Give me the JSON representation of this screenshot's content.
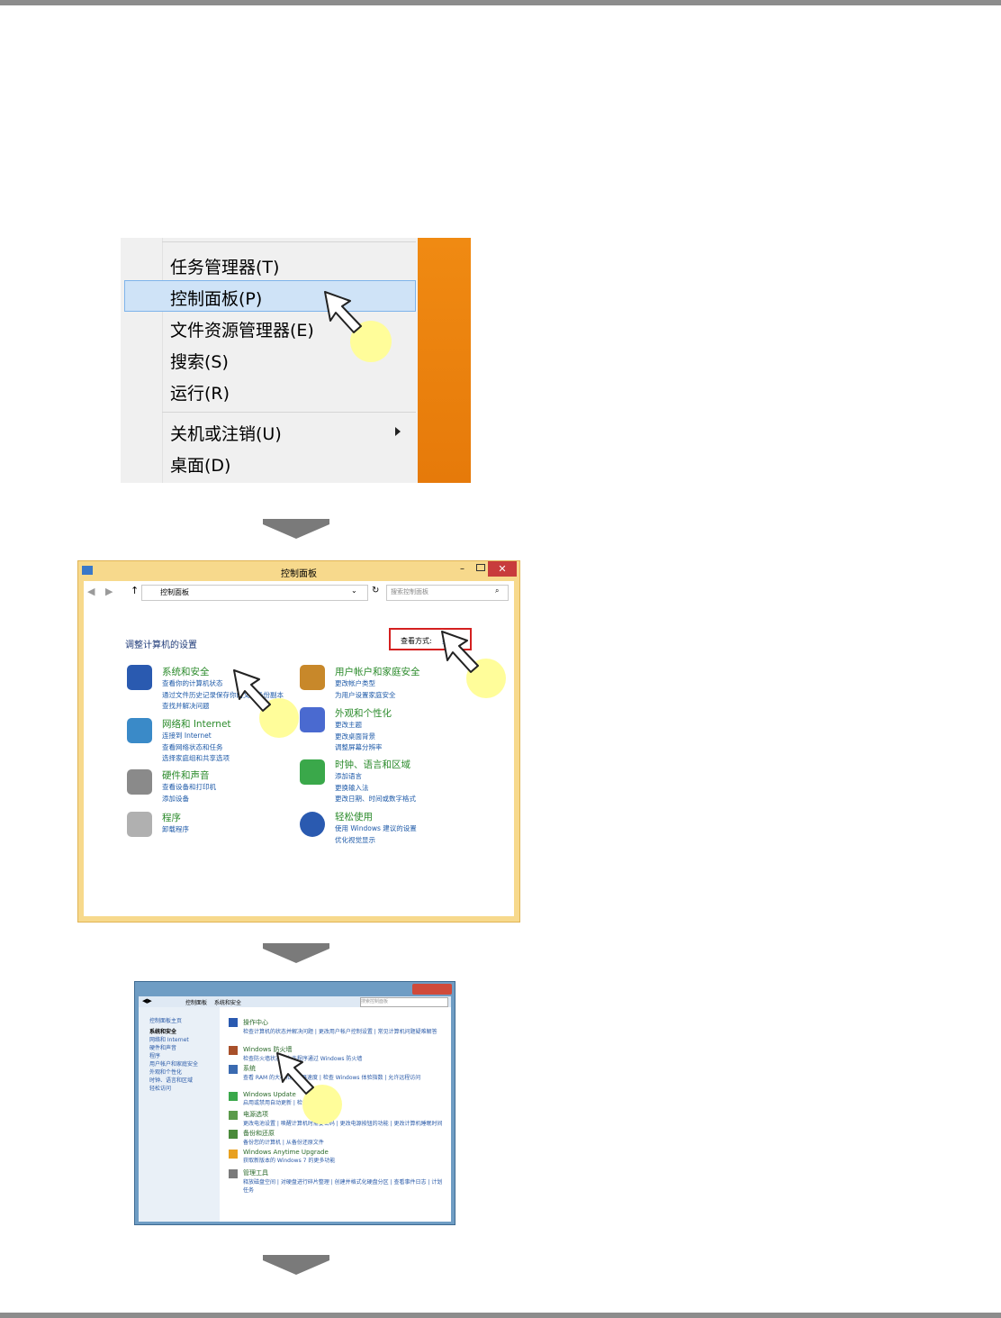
{
  "context_menu": {
    "items": [
      "任务管理器(T)",
      "控制面板(P)",
      "文件资源管理器(E)",
      "搜索(S)",
      "运行(R)",
      "关机或注销(U)",
      "桌面(D)"
    ]
  },
  "control_panel": {
    "window_title": "控制面板",
    "breadcrumb": "控制面板",
    "search_placeholder": "搜索控制面板",
    "heading": "调整计算机的设置",
    "view_by_label": "查看方式:",
    "view_by_value": "类别",
    "categories": [
      {
        "title": "系统和安全",
        "links": [
          "查看你的计算机状态",
          "通过文件历史记录保存你的文件备份副本",
          "查找并解决问题"
        ]
      },
      {
        "title": "网络和 Internet",
        "links": [
          "连接到 Internet",
          "查看网络状态和任务",
          "选择家庭组和共享选项"
        ]
      },
      {
        "title": "硬件和声音",
        "links": [
          "查看设备和打印机",
          "添加设备"
        ]
      },
      {
        "title": "程序",
        "links": [
          "卸载程序"
        ]
      },
      {
        "title": "用户帐户和家庭安全",
        "links": [
          "更改帐户类型",
          "为用户设置家庭安全"
        ]
      },
      {
        "title": "外观和个性化",
        "links": [
          "更改主题",
          "更改桌面背景",
          "调整屏幕分辨率"
        ]
      },
      {
        "title": "时钟、语言和区域",
        "links": [
          "添加语言",
          "更换输入法",
          "更改日期、时间或数字格式"
        ]
      },
      {
        "title": "轻松使用",
        "links": [
          "使用 Windows 建议的设置",
          "优化视觉显示"
        ]
      }
    ]
  },
  "system_security": {
    "breadcrumb": [
      "控制面板",
      "系统和安全"
    ],
    "search_placeholder": "搜索控制面板",
    "sidebar": [
      "控制面板主页",
      "系统和安全",
      "网络和 Internet",
      "硬件和声音",
      "程序",
      "用户帐户和家庭安全",
      "外观和个性化",
      "时钟、语言和区域",
      "轻松访问"
    ],
    "sections": [
      {
        "title": "操作中心",
        "links": "检查计算机的状态并解决问题 | 更改用户帐户控制设置 | 常见计算机问题疑难解答"
      },
      {
        "title": "Windows 防火墙",
        "links": "检查防火墙状态 | 允许程序通过 Windows 防火墙"
      },
      {
        "title": "系统",
        "links": "查看 RAM 的大小和处理器速度 | 检查 Windows 体验指数 | 允许远程访问"
      },
      {
        "title": "Windows Update",
        "links": "启用或禁用自动更新 | 检查更新"
      },
      {
        "title": "电源选项",
        "links": "更改电池设置 | 唤醒计算机时需要密码 | 更改电源按钮的功能 | 更改计算机睡眠时间"
      },
      {
        "title": "备份和还原",
        "links": "备份您的计算机 | 从备份还原文件"
      },
      {
        "title": "Windows Anytime Upgrade",
        "links": "获取新版本的 Windows 7 的更多功能"
      },
      {
        "title": "管理工具",
        "links": "释放磁盘空间 | 对硬盘进行碎片整理 | 创建并格式化硬盘分区 | 查看事件日志 | 计划任务"
      }
    ]
  },
  "colors": {
    "highlight": "#cfe3f7",
    "callout": "#fffd9a",
    "rule": "#8c8c8c",
    "arrow": "#7a7a7a"
  }
}
